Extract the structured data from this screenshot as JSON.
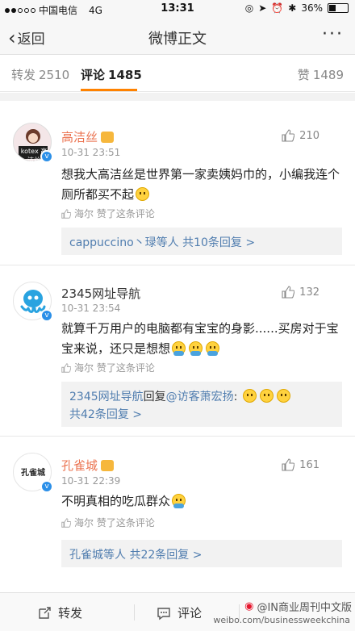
{
  "status": {
    "carrier": "中国电信",
    "network": "4G",
    "time": "13:31",
    "battery": "36%",
    "battery_level": 0.36
  },
  "nav": {
    "back_label": "返回",
    "title": "微博正文",
    "more_label": "···"
  },
  "tabs": [
    {
      "label": "转发",
      "count": "2510"
    },
    {
      "label": "评论",
      "count": "1485"
    },
    {
      "label": "赞",
      "count": "1489"
    }
  ],
  "comments": [
    {
      "name": "高洁丝",
      "time": "10-31 23:51",
      "likes": "210",
      "avatar_text": "kotex 高洁丝",
      "text": "想我大高洁丝是世界第一家卖姨妈巾的，小编我连个厕所都买不起",
      "liked_by": "海尔 赞了这条评论",
      "reply_users": "cappuccino丶琭等人",
      "reply_count": "共10条回复 >"
    },
    {
      "name": "2345网址导航",
      "time": "10-31 23:54",
      "likes": "132",
      "text": "就算千万用户的电脑都有宝宝的身影......买房对于宝宝来说，还只是想想",
      "liked_by": "海尔 赞了这条评论",
      "reply_user": "2345网址导航",
      "reply_verb": "回复",
      "reply_target": "@访客萧宏扬",
      "reply_colon": ":",
      "reply_count": "共42条回复 >"
    },
    {
      "name": "孔雀城",
      "time": "10-31 22:39",
      "likes": "161",
      "avatar_text": "孔雀城",
      "text": "不明真相的吃瓜群众",
      "liked_by": "海尔 赞了这条评论",
      "reply_users": "孔雀城等人",
      "reply_count": "共22条回复 >"
    }
  ],
  "bottom": {
    "repost_label": "转发",
    "comment_label": "评论",
    "watermark_handle": "@IN商业周刊中文版",
    "watermark_url": "weibo.com/businessweekchina"
  },
  "colors": {
    "accent": "#ff8200",
    "name_orange": "#eb7350",
    "link_blue": "#507daf",
    "verified_blue": "#2b8fe8"
  }
}
